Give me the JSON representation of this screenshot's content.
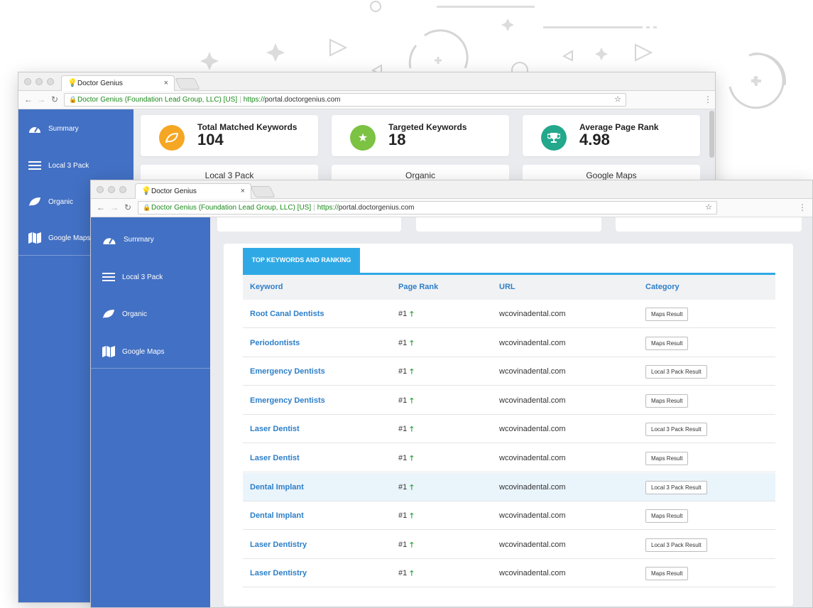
{
  "colors": {
    "sidebar": "#4270c4",
    "accent": "#2fa9e6",
    "link": "#2d7fc8",
    "up_arrow": "#1f9a2c",
    "stat_icon_1": "#f5a623",
    "stat_icon_2": "#7cc243",
    "stat_icon_3": "#23a88c"
  },
  "browser": {
    "tab_title": "Doctor Genius",
    "tab_close": "×",
    "cert_name": "Doctor Genius (Foundation Lead Group, LLC) [US]",
    "url_scheme": "https://",
    "url_host": "portal.doctorgenius.com"
  },
  "sidebar": {
    "items": [
      {
        "label": "Summary",
        "icon": "dashboard-icon"
      },
      {
        "label": "Local 3 Pack",
        "icon": "menu-icon"
      },
      {
        "label": "Organic",
        "icon": "leaf-icon"
      },
      {
        "label": "Google Maps",
        "icon": "map-icon"
      }
    ]
  },
  "stats": [
    {
      "label": "Total Matched Keywords",
      "value": "104",
      "icon": "leaf-icon"
    },
    {
      "label": "Targeted Keywords",
      "value": "18",
      "icon": "star-icon"
    },
    {
      "label": "Average Page Rank",
      "value": "4.98",
      "icon": "trophy-icon"
    }
  ],
  "subcards": [
    "Local 3 Pack",
    "Organic",
    "Google Maps"
  ],
  "table": {
    "tab_label": "TOP KEYWORDS AND RANKING",
    "headers": {
      "keyword": "Keyword",
      "rank": "Page Rank",
      "url": "URL",
      "category": "Category"
    },
    "rows": [
      {
        "keyword": "Root Canal Dentists",
        "rank": "#1",
        "url": "wcovinadental.com",
        "category": "Maps Result"
      },
      {
        "keyword": "Periodontists",
        "rank": "#1",
        "url": "wcovinadental.com",
        "category": "Maps Result"
      },
      {
        "keyword": "Emergency Dentists",
        "rank": "#1",
        "url": "wcovinadental.com",
        "category": "Local 3 Pack Result"
      },
      {
        "keyword": "Emergency Dentists",
        "rank": "#1",
        "url": "wcovinadental.com",
        "category": "Maps Result"
      },
      {
        "keyword": "Laser Dentist",
        "rank": "#1",
        "url": "wcovinadental.com",
        "category": "Local 3 Pack Result"
      },
      {
        "keyword": "Laser Dentist",
        "rank": "#1",
        "url": "wcovinadental.com",
        "category": "Maps Result"
      },
      {
        "keyword": "Dental Implant",
        "rank": "#1",
        "url": "wcovinadental.com",
        "category": "Local 3 Pack Result",
        "highlighted": true
      },
      {
        "keyword": "Dental Implant",
        "rank": "#1",
        "url": "wcovinadental.com",
        "category": "Maps Result"
      },
      {
        "keyword": "Laser Dentistry",
        "rank": "#1",
        "url": "wcovinadental.com",
        "category": "Local 3 Pack Result"
      },
      {
        "keyword": "Laser Dentistry",
        "rank": "#1",
        "url": "wcovinadental.com",
        "category": "Maps Result"
      }
    ]
  }
}
